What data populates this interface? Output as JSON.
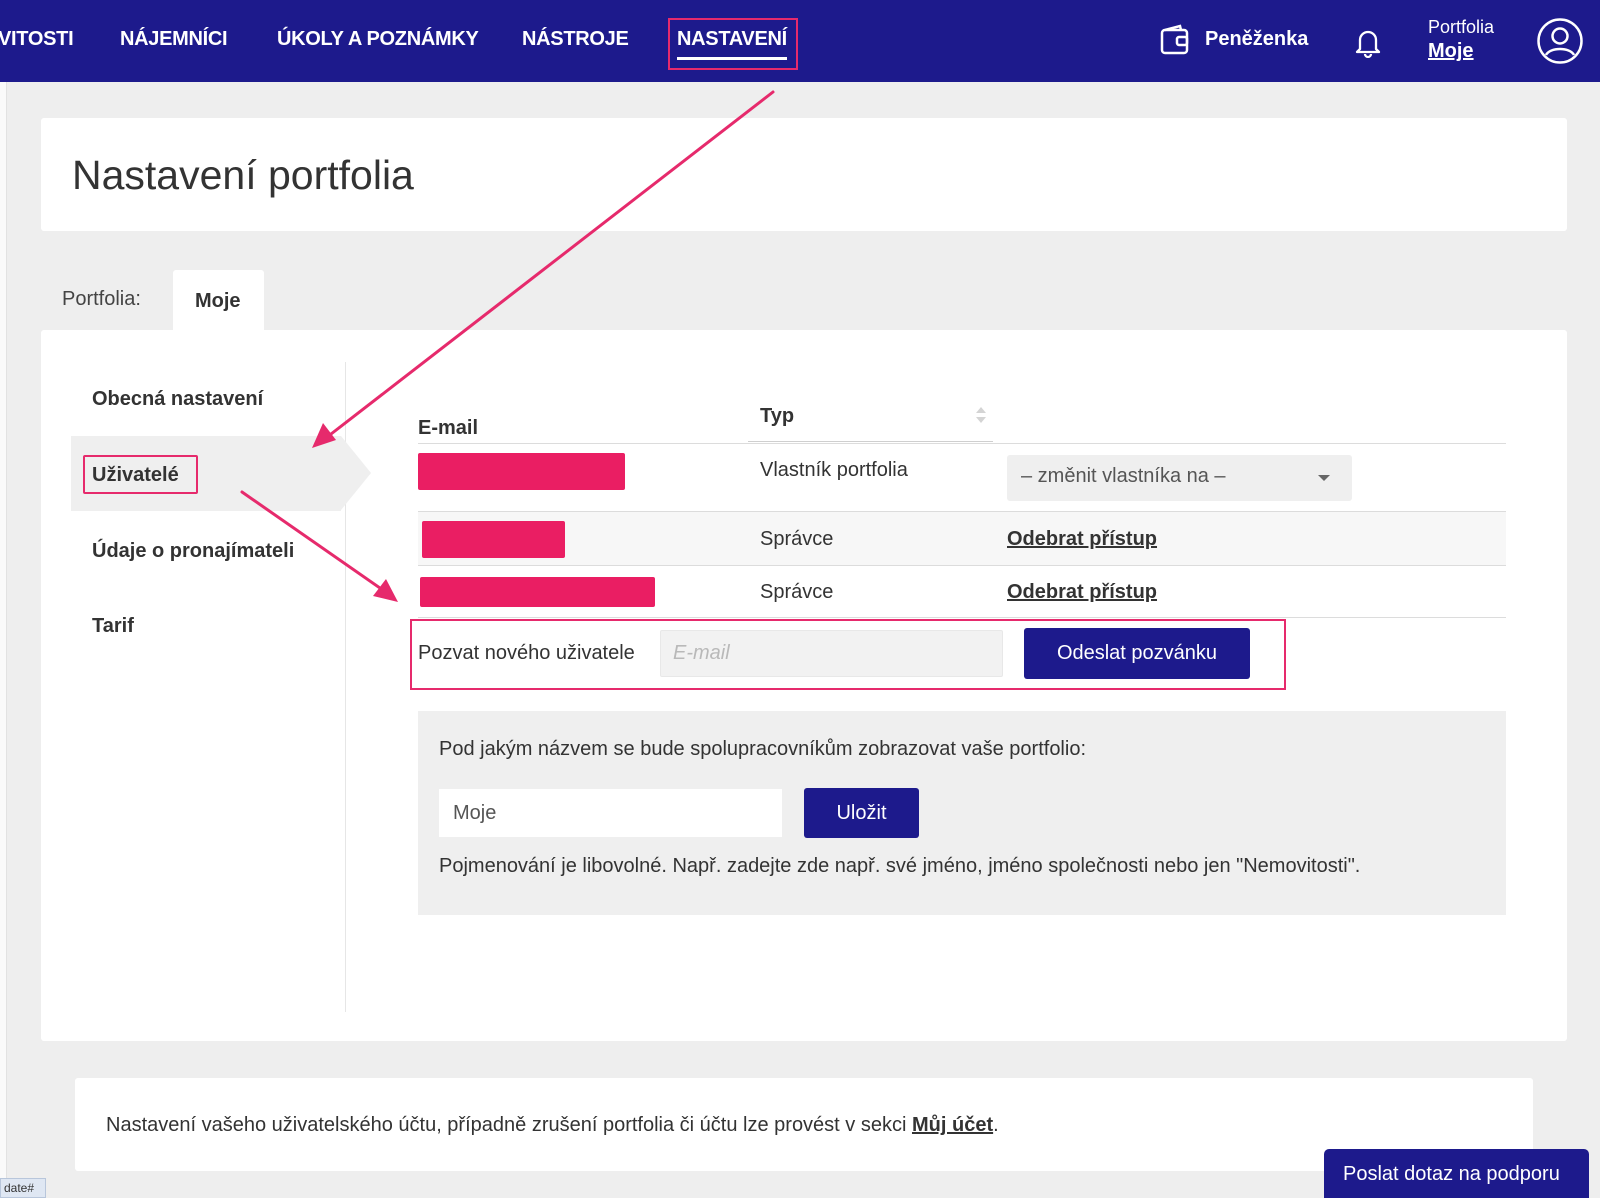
{
  "nav": {
    "items": [
      "VITOSTI",
      "NÁJEMNÍCI",
      "ÚKOLY A POZNÁMKY",
      "NÁSTROJE",
      "NASTAVENÍ"
    ],
    "wallet_label": "Peněženka",
    "portfolio_small": "Portfolia",
    "portfolio_name": "Moje"
  },
  "page": {
    "title": "Nastavení portfolia"
  },
  "tabs": {
    "label": "Portfolia:",
    "active": "Moje"
  },
  "sidebar": {
    "items": [
      {
        "label": "Obecná nastavení"
      },
      {
        "label": "Uživatelé",
        "active": true
      },
      {
        "label": "Údaje o pronajímateli"
      },
      {
        "label": "Tarif"
      }
    ]
  },
  "users_table": {
    "headers": {
      "email": "E-mail",
      "type": "Typ"
    },
    "rows": [
      {
        "type": "Vlastník portfolia",
        "action": "– změnit vlastníka na –"
      },
      {
        "type": "Správce",
        "action": "Odebrat přístup"
      },
      {
        "type": "Správce",
        "action": "Odebrat přístup"
      }
    ]
  },
  "invite": {
    "label": "Pozvat nového uživatele",
    "email_placeholder": "E-mail",
    "button": "Odeslat pozvánku"
  },
  "portfolio_name": {
    "question": "Pod jakým názvem se bude spolupracovníkům zobrazovat vaše portfolio:",
    "value": "Moje",
    "save_button": "Uložit",
    "hint": "Pojmenování je libovolné. Např. zadejte zde např. své jméno, jméno společnosti nebo jen \"Nemovitosti\"."
  },
  "footer": {
    "text_before": "Nastavení vašeho uživatelského účtu, případně zrušení portfolia či účtu lze provést v sekci ",
    "link": "Můj účet",
    "text_after": "."
  },
  "support_button": "Poslat dotaz na podporu",
  "status_bar": "date#",
  "colors": {
    "brand": "#1d1a8c",
    "highlight": "#e62a6c",
    "redaction": "#ea1e63"
  }
}
